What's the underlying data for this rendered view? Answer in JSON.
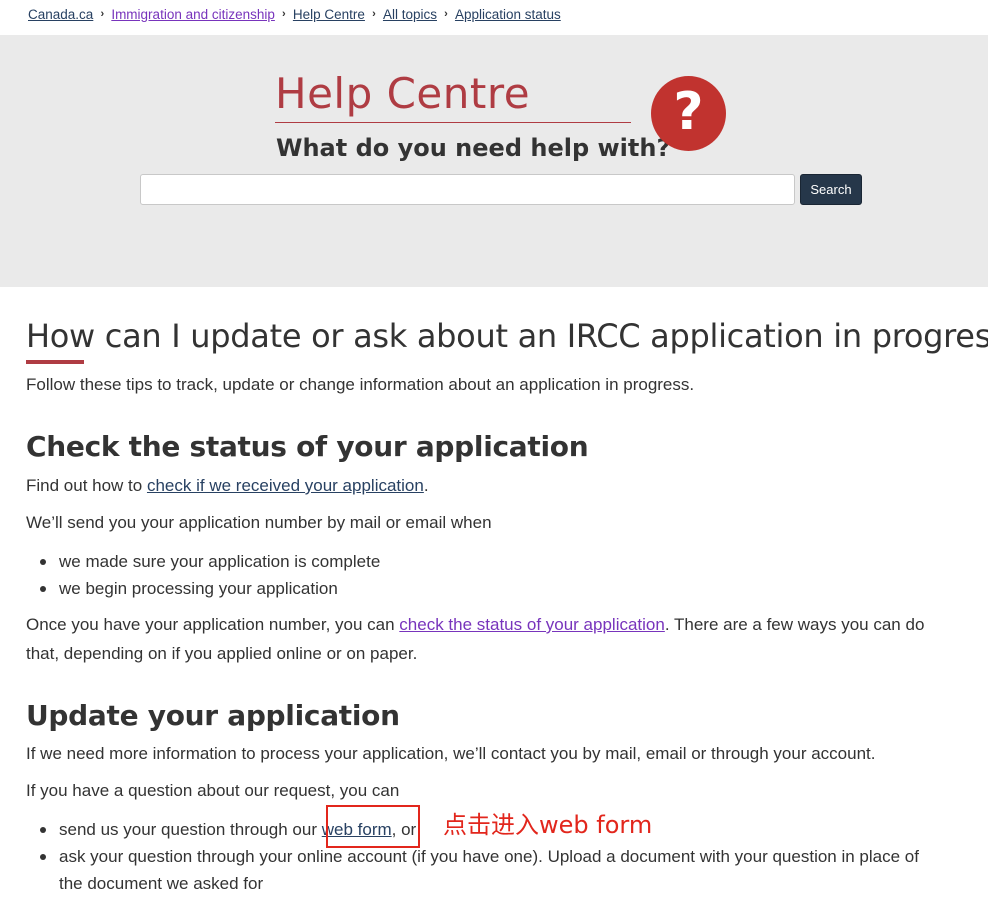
{
  "breadcrumb": {
    "items": [
      {
        "label": "Canada.ca",
        "visited": false
      },
      {
        "label": "Immigration and citizenship",
        "visited": true
      },
      {
        "label": "Help Centre",
        "visited": false
      },
      {
        "label": "All topics",
        "visited": false
      },
      {
        "label": "Application status",
        "visited": false
      }
    ],
    "separator": "›"
  },
  "banner": {
    "title": "Help Centre",
    "subtitle": "What do you need help with?",
    "icon": "question-mark-icon",
    "icon_glyph": "?",
    "search": {
      "value": "",
      "placeholder": "",
      "button_label": "Search"
    }
  },
  "content": {
    "page_title": "How can I update or ask about an IRCC application in progress?",
    "intro": "Follow these tips to track, update or change information about an application in progress.",
    "section1": {
      "heading": "Check the status of your application",
      "p1_before": "Find out how to ",
      "p1_link": "check if we received your application",
      "p1_after": ".",
      "p2": "We’ll send you your application number by mail or email when",
      "bullets": [
        "we made sure your application is complete",
        "we begin processing your application"
      ],
      "p3_before": "Once you have your application number, you can ",
      "p3_link": "check the status of your application",
      "p3_after": ". There are a few ways you can do",
      "p3_line2": "that, depending on if you applied online or on paper."
    },
    "section2": {
      "heading": "Update your application",
      "p1": "If we need more information to process your application, we’ll contact you by mail, email or through your account.",
      "p2": "If you have a question about our request, you can",
      "bullet1_before": "send us your question through our ",
      "bullet1_link": "web form",
      "bullet1_after": ", or",
      "bullet2_line1": "ask your question through your online account (if you have one). Upload a document with your question in place of",
      "bullet2_line2": "the document we asked for"
    }
  },
  "annotation": {
    "text": "点击进入web form",
    "color": "#e2261c"
  },
  "colors": {
    "brand_red": "#af3c43",
    "link": "#284162",
    "visited_link": "#7834bc",
    "button": "#26374a",
    "banner_bg": "#eaeaea"
  }
}
